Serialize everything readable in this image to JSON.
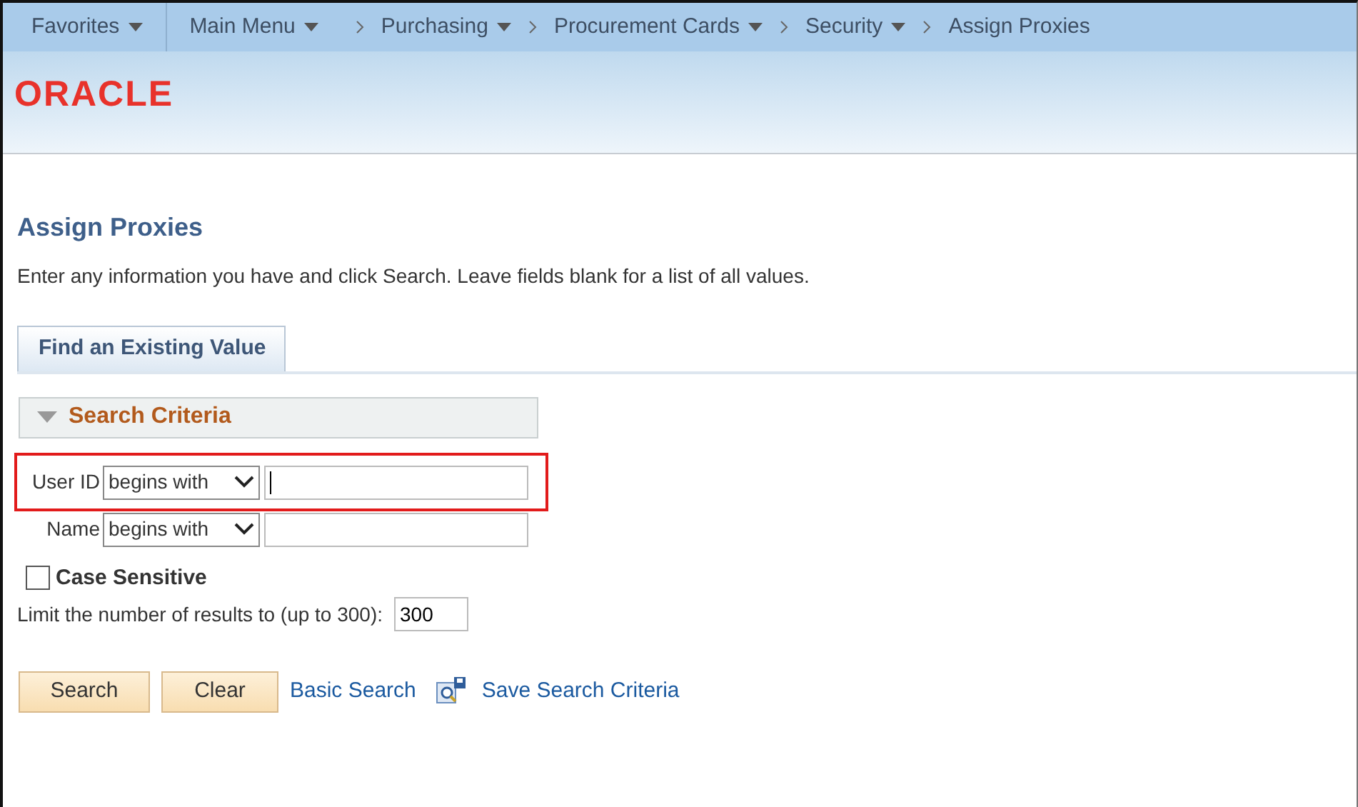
{
  "breadcrumbs": [
    {
      "label": "Favorites",
      "dropdown": true
    },
    {
      "label": "Main Menu",
      "dropdown": true
    },
    {
      "label": "Purchasing",
      "dropdown": true
    },
    {
      "label": "Procurement Cards",
      "dropdown": true
    },
    {
      "label": "Security",
      "dropdown": true
    },
    {
      "label": "Assign Proxies",
      "dropdown": false
    }
  ],
  "logo": "ORACLE",
  "page_title": "Assign Proxies",
  "instructions": "Enter any information you have and click Search. Leave fields blank for a list of all values.",
  "tabs": [
    {
      "label": "Find an Existing Value",
      "selected": true
    }
  ],
  "section": {
    "title": "Search Criteria",
    "expanded": true
  },
  "criteria": [
    {
      "label": "User ID",
      "operator": "begins with",
      "focused": true,
      "highlighted": true
    },
    {
      "label": "Name",
      "operator": "begins with",
      "focused": false,
      "highlighted": false
    }
  ],
  "case_sensitive": {
    "label": "Case Sensitive",
    "checked": false
  },
  "limit": {
    "label": "Limit the number of results to (up to 300):",
    "value": "300"
  },
  "buttons": [
    "Search",
    "Clear"
  ],
  "links": [
    {
      "label": "Basic Search",
      "icon": false
    },
    {
      "label": "Save Search Criteria",
      "icon": true
    }
  ]
}
